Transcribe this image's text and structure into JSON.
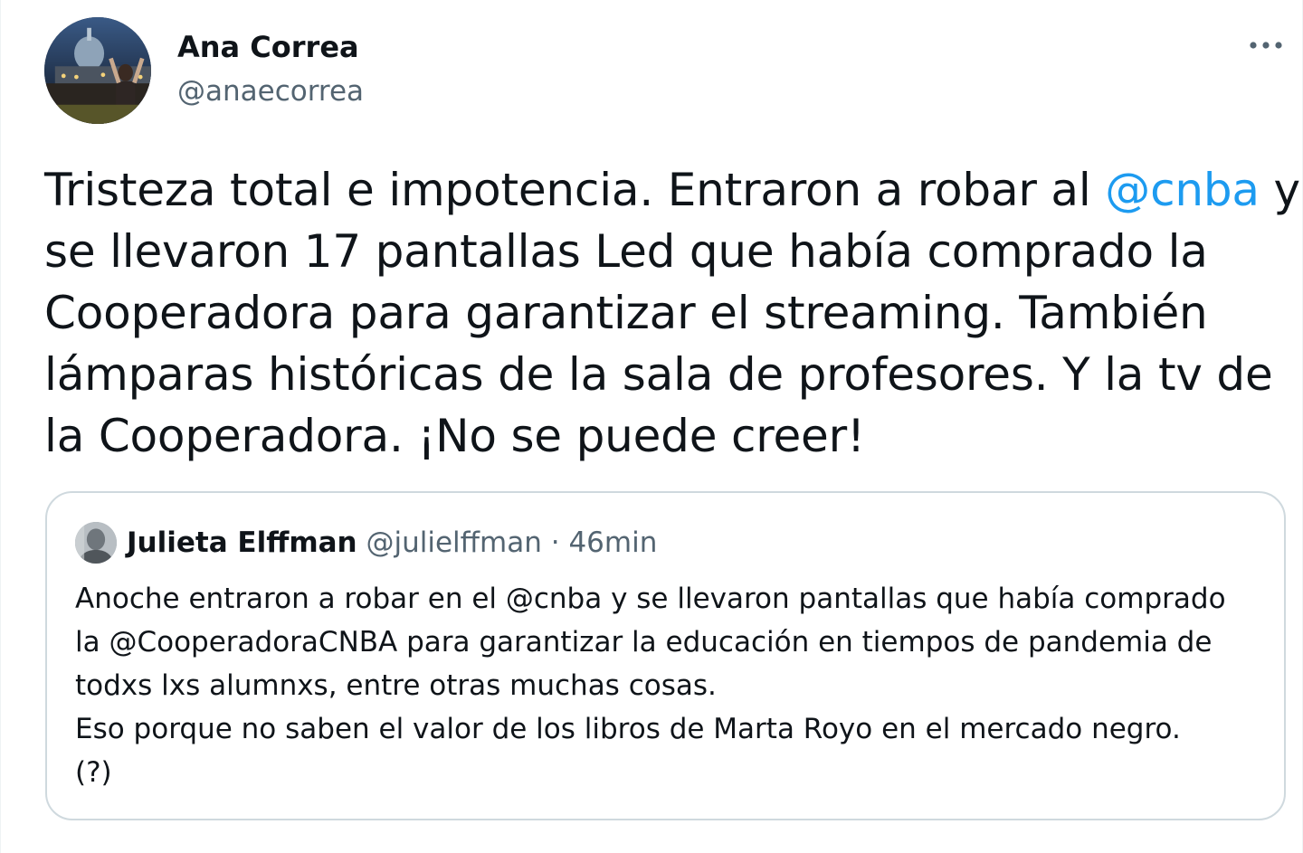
{
  "author": {
    "name": "Ana Correa",
    "handle": "@anaecorrea",
    "avatar_icon": "profile-photo"
  },
  "more_icon": "ellipsis-icon",
  "tweet": {
    "lines": [
      [
        "Tristeza total e impotencia. Entraron a robar al ",
        "@cnba",
        " y"
      ],
      "se llevaron 17 pantallas Led que había comprado la",
      "Cooperadora para garantizar el streaming. También",
      "lámparas históricas de la sala de profesores. Y la tv de",
      "la Cooperadora. ¡No se puede creer!"
    ]
  },
  "quote": {
    "name": "Julieta Elffman",
    "handle": "@julielffman",
    "separator": "·",
    "time": "46min",
    "lines": [
      "Anoche entraron a robar en el @cnba y se llevaron pantallas que había comprado",
      "la @CooperadoraCNBA para garantizar la educación en tiempos de pandemia de",
      "todxs lxs alumnxs, entre otras muchas cosas.",
      "Eso porque no saben el valor de los libros de Marta Royo en el mercado negro.",
      "(?)"
    ]
  },
  "colors": {
    "text": "#0f1419",
    "secondary": "#536471",
    "link": "#1d9bf0",
    "border": "#cfd9de"
  }
}
